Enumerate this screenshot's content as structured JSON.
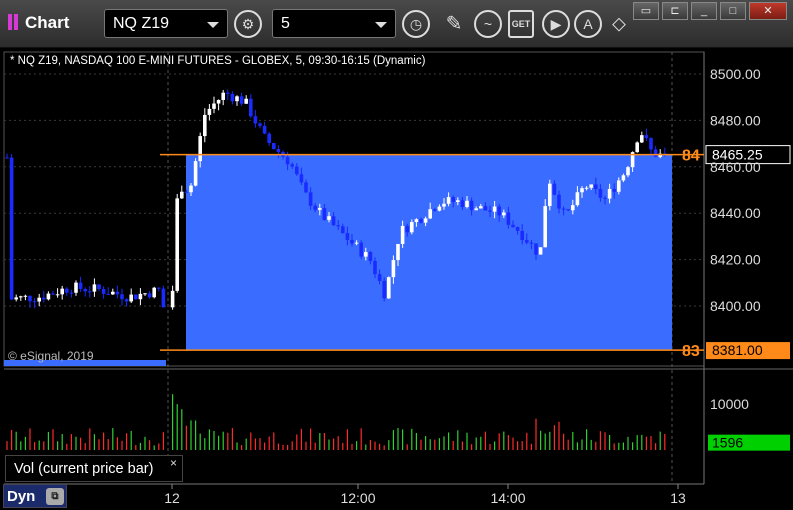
{
  "toolbar": {
    "app_title": "Chart",
    "symbol": "NQ Z19",
    "interval": "5",
    "icons": [
      "gear-icon",
      "clock-icon",
      "pencil-icon",
      "study-icon",
      "get-icon",
      "play-icon",
      "alert-icon",
      "sync-icon"
    ],
    "window_buttons": [
      "restore-icon",
      "maximize-icon",
      "close-icon"
    ]
  },
  "chart": {
    "info_line": "* NQ Z19, NASDAQ 100 E-MINI FUTURES - GLOBEX, 5, 09:30-16:15 (Dynamic)",
    "copyright": "© eSignal, 2019",
    "vol_label": "Vol (current price bar)",
    "vol_close": "×",
    "mode": "Dyn",
    "mode_icon": "chart-lock-icon",
    "colors": {
      "up": "#ffffff",
      "down": "#1a2bff",
      "zone": "#3a6cff",
      "level": "#ff8a1a",
      "vol_up": "#2fd02f",
      "vol_down": "#ff2a2a",
      "last": "#00d000"
    }
  },
  "chart_data": {
    "type": "candlestick",
    "title": "NQ Z19, NASDAQ 100 E-MINI FUTURES - GLOBEX, 5, 09:30-16:15 (Dynamic)",
    "ylim": [
      8370,
      8510
    ],
    "yticks": [
      "8500.00",
      "8480.00",
      "8460.00",
      "8440.00",
      "8420.00",
      "8400.00"
    ],
    "xticks": [
      "12",
      "12:00",
      "14:00",
      "13"
    ],
    "levels": [
      {
        "axis_label": "84",
        "tag": "8465.25",
        "value": 8465.25
      },
      {
        "axis_label": "83",
        "tag": "8381.00",
        "value": 8381.0
      }
    ],
    "volume": {
      "ylim": [
        0,
        12500
      ],
      "ytick": "10000",
      "ytick_value": 10000,
      "last_tag": "1596",
      "last_value": 1596
    }
  }
}
